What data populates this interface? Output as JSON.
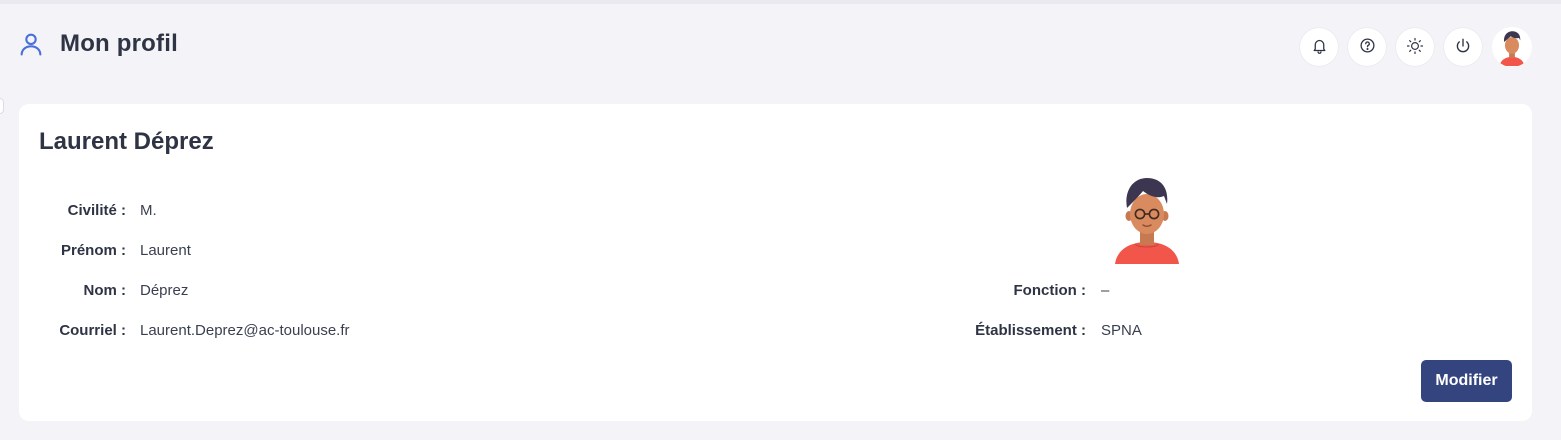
{
  "header": {
    "title": "Mon profil",
    "title_icon": "user-icon",
    "actions": [
      {
        "name": "notifications",
        "icon": "bell-icon"
      },
      {
        "name": "help",
        "icon": "question-circle-icon"
      },
      {
        "name": "theme",
        "icon": "sun-icon"
      },
      {
        "name": "logout",
        "icon": "power-icon"
      },
      {
        "name": "account",
        "icon": "avatar"
      }
    ]
  },
  "profile": {
    "full_name": "Laurent Déprez",
    "left_fields": [
      {
        "label": "Civilité :",
        "value": "M."
      },
      {
        "label": "Prénom :",
        "value": "Laurent"
      },
      {
        "label": "Nom :",
        "value": "Déprez"
      },
      {
        "label": "Courriel :",
        "value": "Laurent.Deprez@ac-toulouse.fr"
      }
    ],
    "right_fields": [
      {
        "label": "Fonction :",
        "value": "–"
      },
      {
        "label": "Établissement :",
        "value": "SPNA"
      }
    ],
    "modify_label": "Modifier"
  },
  "colors": {
    "background": "#f4f4f8",
    "card": "#ffffff",
    "primary_button": "#34447f",
    "accent_icon": "#4a6fd8",
    "text": "#2f3445"
  }
}
